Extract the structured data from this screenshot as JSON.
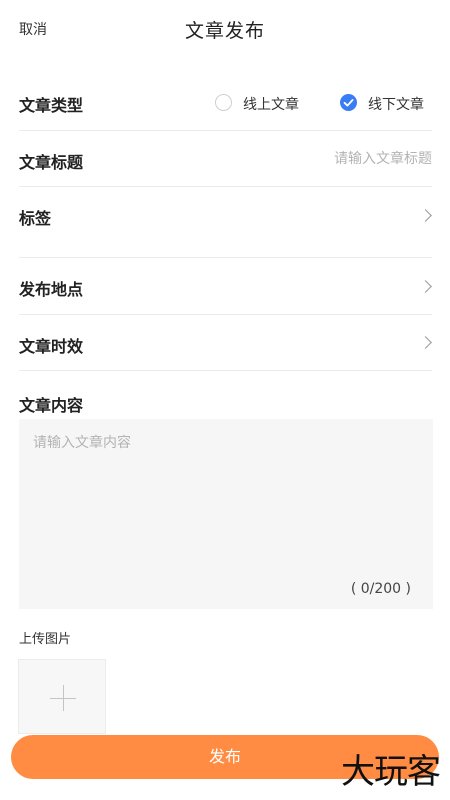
{
  "header": {
    "cancel_label": "取消",
    "title": "文章发布"
  },
  "form": {
    "article_type": {
      "label": "文章类型",
      "options": [
        {
          "label": "线上文章",
          "selected": false
        },
        {
          "label": "线下文章",
          "selected": true
        }
      ]
    },
    "article_title": {
      "label": "文章标题",
      "placeholder": "请输入文章标题"
    },
    "tags": {
      "label": "标签"
    },
    "location": {
      "label": "发布地点"
    },
    "validity": {
      "label": "文章时效"
    },
    "content": {
      "label": "文章内容",
      "placeholder": "请输入文章内容",
      "counter": "( 0/200 )"
    },
    "upload": {
      "label": "上传图片"
    }
  },
  "footer": {
    "publish_label": "发布"
  },
  "watermark": {
    "text": "大玩客"
  },
  "colors": {
    "accent": "#3a7cf3",
    "publish_button": "#ff8c42"
  },
  "icons": {
    "chevron": "chevron-right-icon",
    "check": "check-icon",
    "plus": "plus-icon"
  }
}
